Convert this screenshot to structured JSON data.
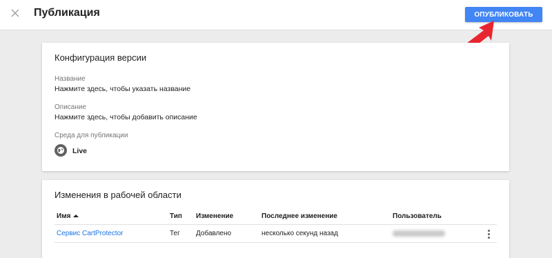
{
  "header": {
    "title": "Публикация",
    "publish_label": "ОПУБЛИКОВАТЬ",
    "close_icon": "close-icon",
    "accent_color": "#4285f4",
    "annotation_color": "#e8262f"
  },
  "config": {
    "title": "Конфигурация версии",
    "name_label": "Название",
    "name_value": "Нажмите здесь, чтобы указать название",
    "description_label": "Описание",
    "description_value": "Нажмите здесь, чтобы добавить описание",
    "environment_label": "Среда для публикации",
    "environment_icon": "globe-icon",
    "environment_value": "Live"
  },
  "changes": {
    "title": "Изменения в рабочей области",
    "columns": {
      "name": "Имя",
      "sort_icon": "sort-up-icon",
      "type": "Тип",
      "change": "Изменение",
      "last_change": "Последнее изменение",
      "user": "Пользователь"
    },
    "rows": [
      {
        "name": "Сервис CartProtector",
        "type": "Тег",
        "change": "Добавлено",
        "last_change": "несколько секунд назад",
        "more_icon": "more-vert-icon"
      }
    ]
  }
}
